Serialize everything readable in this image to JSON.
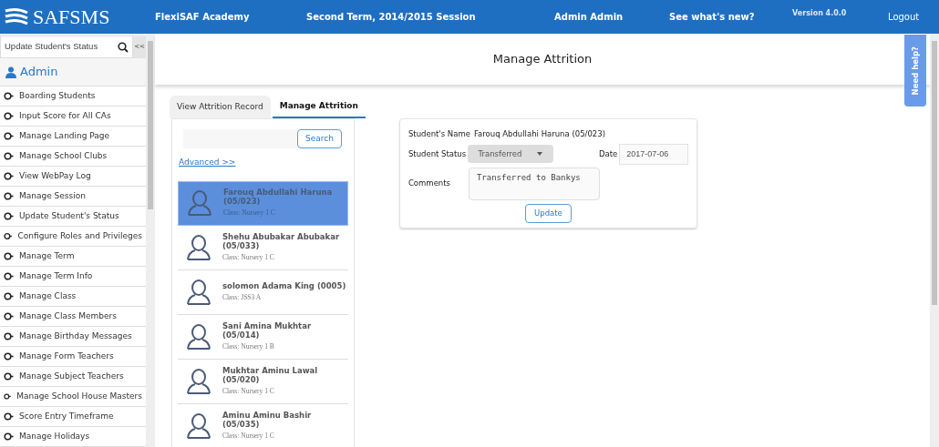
{
  "header": {
    "logo_text": "SAFSMS",
    "school": "FlexiSAF Academy",
    "session": "Second Term, 2014/2015 Session",
    "user": "Admin Admin",
    "whats_new": "See what's new?",
    "version": "Version 4.0.0",
    "logout": "Logout"
  },
  "sidebar": {
    "search_value": "Update Student's Status",
    "collapse": "<<",
    "section": "Admin",
    "items": [
      {
        "label": "Boarding Students"
      },
      {
        "label": "Input Score for All CAs"
      },
      {
        "label": "Manage Landing Page"
      },
      {
        "label": "Manage School Clubs"
      },
      {
        "label": "View WebPay Log"
      },
      {
        "label": "Manage Session"
      },
      {
        "label": "Update Student's Status"
      },
      {
        "label": "Configure Roles and Privileges"
      },
      {
        "label": "Manage Term"
      },
      {
        "label": "Manage Term Info"
      },
      {
        "label": "Manage Class"
      },
      {
        "label": "Manage Class Members"
      },
      {
        "label": "Manage Birthday Messages"
      },
      {
        "label": "Manage Form Teachers"
      },
      {
        "label": "Manage Subject Teachers"
      },
      {
        "label": "Manage School House Masters"
      },
      {
        "label": "Score Entry Timeframe"
      },
      {
        "label": "Manage Holidays"
      }
    ]
  },
  "page_title": "Manage Attrition",
  "help_tab": "Need help?",
  "tabs": [
    {
      "label": "View Attrition Record",
      "selected": false
    },
    {
      "label": "Manage Attrition",
      "selected": true
    }
  ],
  "search": {
    "button": "Search",
    "advanced": "Advanced >>"
  },
  "students": [
    {
      "name": "Farouq Abdullahi Haruna (05/023)",
      "class": "Class: Nursery 1 C",
      "selected": true
    },
    {
      "name": "Shehu Abubakar Abubakar (05/033)",
      "class": "Class: Nursery 1 C",
      "selected": false
    },
    {
      "name": "solomon Adama King (0005)",
      "class": "Class: JSS3 A",
      "selected": false
    },
    {
      "name": "Sani Amina Mukhtar (05/014)",
      "class": "Class: Nursery 1 B",
      "selected": false
    },
    {
      "name": "Mukhtar Aminu Lawal (05/020)",
      "class": "Class: Nursery 1 C",
      "selected": false
    },
    {
      "name": "Aminu Aminu Bashir (05/035)",
      "class": "Class: Nursery 1 C",
      "selected": false
    }
  ],
  "form": {
    "name_label": "Student's Name",
    "name_value": "Farouq Abdullahi Haruna (05/023)",
    "status_label": "Student Status",
    "status_value": "Transferred",
    "date_label": "Date",
    "date_value": "2017-07-06",
    "comments_label": "Comments",
    "comments_value": "Transferred to Bankys",
    "button": "Update"
  }
}
